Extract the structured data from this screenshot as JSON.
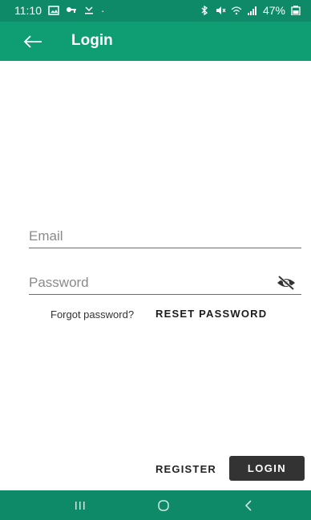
{
  "status_bar": {
    "time": "11:10",
    "battery": "47%",
    "left_icons": [
      "image-icon",
      "key-icon",
      "download-icon"
    ],
    "right_icons": [
      "bluetooth-icon",
      "mute-icon",
      "wifi-icon",
      "signal-icon",
      "battery-icon"
    ]
  },
  "appbar": {
    "title": "Login",
    "background": "#0f9d74"
  },
  "form": {
    "email_placeholder": "Email",
    "email_value": "",
    "password_placeholder": "Password",
    "password_value": ""
  },
  "reset": {
    "forgot_text": "Forgot password?",
    "reset_label": "RESET PASSWORD"
  },
  "actions": {
    "register_label": "REGISTER",
    "login_label": "LOGIN"
  },
  "nav": {
    "buttons": [
      "recent-apps",
      "home",
      "back"
    ]
  }
}
